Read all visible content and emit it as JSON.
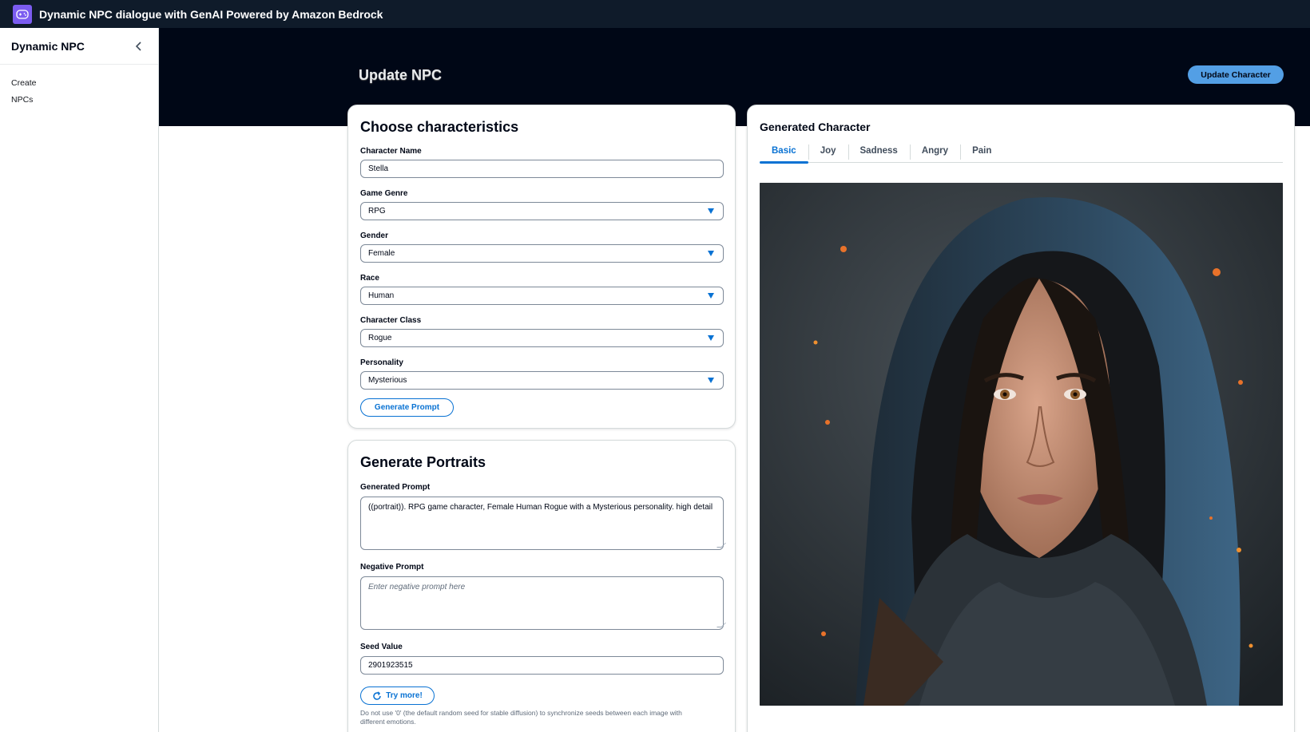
{
  "app": {
    "title": "Dynamic NPC dialogue with GenAI Powered by Amazon Bedrock",
    "logo_icon": "gamepad-icon"
  },
  "sidebar": {
    "title": "Dynamic NPC",
    "collapse_icon": "chevron-left-icon",
    "items": [
      {
        "label": "Create"
      },
      {
        "label": "NPCs"
      }
    ]
  },
  "header": {
    "title": "Update NPC",
    "action_label": "Update Character"
  },
  "characteristics": {
    "title": "Choose characteristics",
    "character_name": {
      "label": "Character Name",
      "value": "Stella"
    },
    "game_genre": {
      "label": "Game Genre",
      "value": "RPG"
    },
    "gender": {
      "label": "Gender",
      "value": "Female"
    },
    "race": {
      "label": "Race",
      "value": "Human"
    },
    "character_class": {
      "label": "Character Class",
      "value": "Rogue"
    },
    "personality": {
      "label": "Personality",
      "value": "Mysterious"
    },
    "generate_label": "Generate Prompt"
  },
  "portraits": {
    "title": "Generate Portraits",
    "generated_prompt": {
      "label": "Generated Prompt",
      "value": "((portrait)). RPG game character, Female Human Rogue with a Mysterious personality. high detail"
    },
    "negative_prompt": {
      "label": "Negative Prompt",
      "placeholder": "Enter negative prompt here"
    },
    "seed": {
      "label": "Seed Value",
      "value": "2901923515"
    },
    "try_more_label": "Try more!",
    "refresh_icon": "refresh-icon",
    "help": "Do not use '0' (the default random seed for stable diffusion) to synchronize seeds between each image with different emotions."
  },
  "generated": {
    "title": "Generated Character",
    "tabs": [
      {
        "label": "Basic"
      },
      {
        "label": "Joy"
      },
      {
        "label": "Sadness"
      },
      {
        "label": "Angry"
      },
      {
        "label": "Pain"
      }
    ],
    "active_tab": "Basic"
  },
  "colors": {
    "accent": "#0972d3",
    "header_bg": "#000716",
    "topbar_bg": "#0f1b2a",
    "primary_button": "#539fe5",
    "logo": "#7b5cf0"
  }
}
